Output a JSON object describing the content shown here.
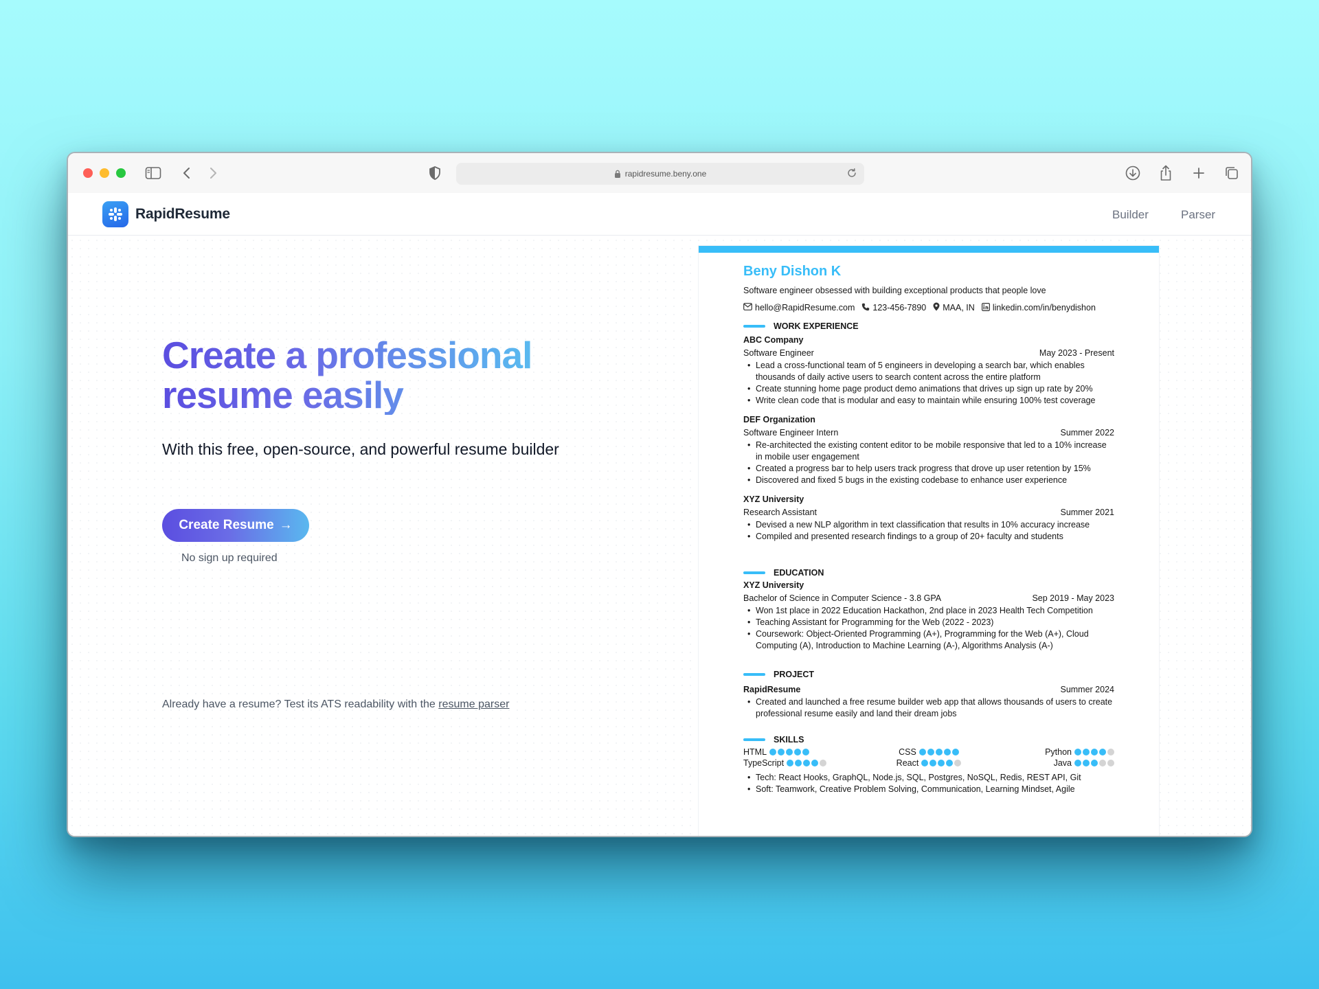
{
  "browser": {
    "url": "rapidresume.beny.one"
  },
  "nav": {
    "brand": "RapidResume",
    "links": [
      "Builder",
      "Parser"
    ]
  },
  "hero": {
    "title_line1": "Create a professional",
    "title_line2": "resume easily",
    "subtitle": "With this free, open-source, and powerful resume builder",
    "cta_label": "Create Resume",
    "cta_arrow": "→",
    "note": "No sign up required",
    "ats_text": "Already have a resume? Test its ATS readability with the",
    "ats_link": "resume parser"
  },
  "resume": {
    "accent": "#38bdf8",
    "name": "Beny Dishon K",
    "summary": "Software engineer obsessed with building exceptional products that people love",
    "contact": {
      "email": "hello@RapidResume.com",
      "phone": "123-456-7890",
      "location": "MAA, IN",
      "linkedin": "linkedin.com/in/benydishon"
    },
    "work_heading": "WORK EXPERIENCE",
    "work": [
      {
        "company": "ABC Company",
        "role": "Software Engineer",
        "date": "May 2023 - Present",
        "bullets": [
          "Lead a cross-functional team of 5 engineers in developing a search bar, which enables thousands of daily active users to search content across the entire platform",
          "Create stunning home page product demo animations that drives up sign up rate by 20%",
          "Write clean code that is modular and easy to maintain while ensuring 100% test coverage"
        ]
      },
      {
        "company": "DEF Organization",
        "role": "Software Engineer Intern",
        "date": "Summer 2022",
        "bullets": [
          "Re-architected the existing content editor to be mobile responsive that led to a 10% increase in mobile user engagement",
          "Created a progress bar to help users track progress that drove up user retention by 15%",
          "Discovered and fixed 5 bugs in the existing codebase to enhance user experience"
        ]
      },
      {
        "company": "XYZ University",
        "role": "Research Assistant",
        "date": "Summer 2021",
        "bullets": [
          "Devised a new NLP algorithm in text classification that results in 10% accuracy increase",
          "Compiled and presented research findings to a group of 20+ faculty and students"
        ]
      }
    ],
    "education_heading": "EDUCATION",
    "education": {
      "school": "XYZ University",
      "degree": "Bachelor of Science in Computer Science - 3.8 GPA",
      "date": "Sep 2019 - May 2023",
      "bullets": [
        "Won 1st place in 2022 Education Hackathon, 2nd place in 2023 Health Tech Competition",
        "Teaching Assistant for Programming for the Web (2022 - 2023)",
        "Coursework: Object-Oriented Programming (A+), Programming for the Web (A+), Cloud Computing (A), Introduction to Machine Learning (A-), Algorithms Analysis (A-)"
      ]
    },
    "project_heading": "PROJECT",
    "project": {
      "name": "RapidResume",
      "date": "Summer 2024",
      "bullets": [
        "Created and launched a free resume builder web app that allows thousands of users to create professional resume easily and land their dream jobs"
      ]
    },
    "skills_heading": "SKILLS",
    "skills": [
      {
        "name": "HTML",
        "rating": 5
      },
      {
        "name": "CSS",
        "rating": 5
      },
      {
        "name": "Python",
        "rating": 4
      },
      {
        "name": "TypeScript",
        "rating": 4
      },
      {
        "name": "React",
        "rating": 4
      },
      {
        "name": "Java",
        "rating": 3
      }
    ],
    "skills_bullets": [
      "Tech: React Hooks, GraphQL, Node.js, SQL, Postgres, NoSQL, Redis, REST API, Git",
      "Soft: Teamwork, Creative Problem Solving, Communication, Learning Mindset, Agile"
    ]
  }
}
